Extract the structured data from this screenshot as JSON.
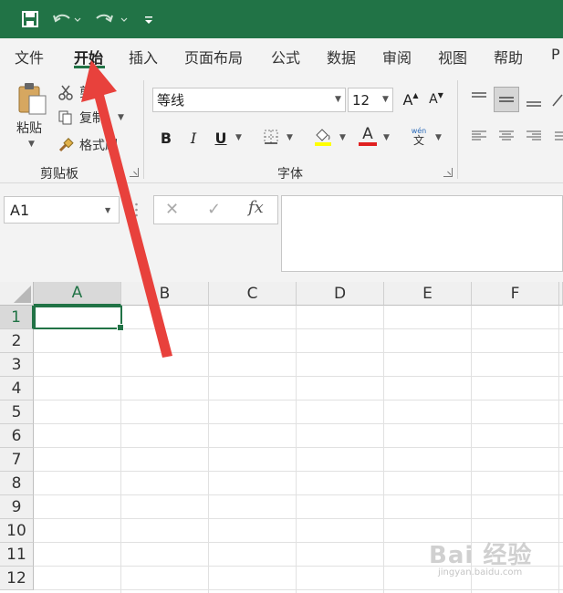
{
  "ribbon_tabs": [
    "文件",
    "开始",
    "插入",
    "页面布局",
    "公式",
    "数据",
    "审阅",
    "视图",
    "帮助",
    "P"
  ],
  "active_tab": "开始",
  "clipboard": {
    "paste_label": "粘贴",
    "cut_label": "剪切",
    "copy_label": "复制",
    "format_painter_label": "格式刷",
    "group_label": "剪贴板"
  },
  "font": {
    "font_name": "等线",
    "font_size": "12",
    "group_label": "字体",
    "bold": "B",
    "italic": "I",
    "underline": "U",
    "grow": "A",
    "shrink": "A",
    "font_color_letter": "A",
    "phonetic_label": "wén",
    "phonetic_char": "文",
    "highlight_color": "#ffff00",
    "font_color": "#e02020"
  },
  "formula_bar": {
    "name_box": "A1",
    "cancel_icon": "✕",
    "enter_icon": "✓",
    "fx_label": "fx",
    "value": ""
  },
  "sheet": {
    "columns": [
      "A",
      "B",
      "C",
      "D",
      "E",
      "F"
    ],
    "rows": [
      "1",
      "2",
      "3",
      "4",
      "5",
      "6",
      "7",
      "8",
      "9",
      "10",
      "11",
      "12"
    ],
    "selected_cell": "A1"
  },
  "watermark": {
    "text": "Bai 经验",
    "sub": "jingyan.baidu.com"
  },
  "colors": {
    "title_bar": "#217346",
    "accent": "#217346",
    "arrow": "#e8413c"
  }
}
